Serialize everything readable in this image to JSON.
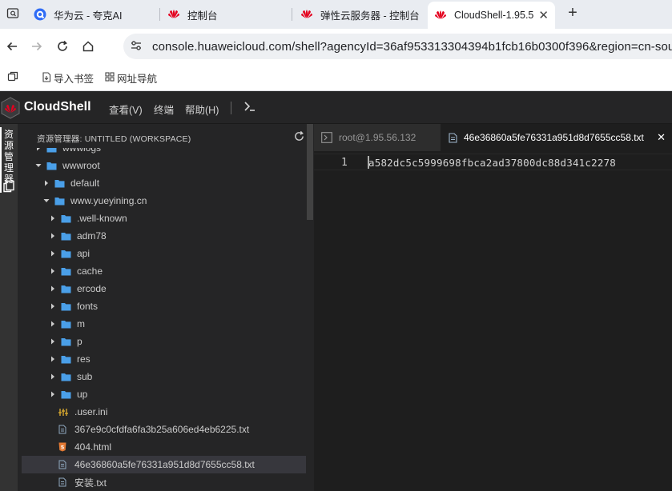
{
  "browser": {
    "tabs": [
      {
        "title": "华为云 - 夸克AI",
        "active": false
      },
      {
        "title": "控制台",
        "active": false
      },
      {
        "title": "弹性云服务器 - 控制台",
        "active": false
      },
      {
        "title": "CloudShell-1.95.5",
        "active": true
      }
    ],
    "new_tab": "+",
    "url": "console.huaweicloud.com/shell?agencyId=36af953313304394b1fcb16b0300f396&region=cn-sou",
    "bookmarks": [
      {
        "label": "导入书签"
      },
      {
        "label": "网址导航"
      }
    ]
  },
  "app": {
    "title": "CloudShell",
    "menu": [
      "查看(V)",
      "终端",
      "帮助(H)"
    ],
    "terminal_glyph": "›_",
    "activity_label": "资源管理器"
  },
  "explorer": {
    "header": "资源管理器: UNTITLED (WORKSPACE)",
    "tree": [
      {
        "label": "wwwlogs",
        "type": "folder",
        "depth": 1,
        "expanded": false,
        "partial": true
      },
      {
        "label": "wwwroot",
        "type": "folder",
        "depth": 1,
        "expanded": true
      },
      {
        "label": "default",
        "type": "folder",
        "depth": 2,
        "expanded": false
      },
      {
        "label": "www.yueyining.cn",
        "type": "folder",
        "depth": 2,
        "expanded": true
      },
      {
        "label": ".well-known",
        "type": "folder",
        "depth": 3,
        "expanded": false
      },
      {
        "label": "adm78",
        "type": "folder",
        "depth": 3,
        "expanded": false
      },
      {
        "label": "api",
        "type": "folder",
        "depth": 3,
        "expanded": false
      },
      {
        "label": "cache",
        "type": "folder",
        "depth": 3,
        "expanded": false
      },
      {
        "label": "ercode",
        "type": "folder",
        "depth": 3,
        "expanded": false
      },
      {
        "label": "fonts",
        "type": "folder",
        "depth": 3,
        "expanded": false
      },
      {
        "label": "m",
        "type": "folder",
        "depth": 3,
        "expanded": false
      },
      {
        "label": "p",
        "type": "folder",
        "depth": 3,
        "expanded": false
      },
      {
        "label": "res",
        "type": "folder",
        "depth": 3,
        "expanded": false
      },
      {
        "label": "sub",
        "type": "folder",
        "depth": 3,
        "expanded": false
      },
      {
        "label": "up",
        "type": "folder",
        "depth": 3,
        "expanded": false
      },
      {
        "label": ".user.ini",
        "type": "ini",
        "depth": 3
      },
      {
        "label": "367e9c0cfdfa6fa3b25a606ed4eb6225.txt",
        "type": "txt",
        "depth": 3
      },
      {
        "label": "404.html",
        "type": "html",
        "depth": 3
      },
      {
        "label": "46e36860a5fe76331a951d8d7655cc58.txt",
        "type": "txt",
        "depth": 3,
        "selected": true
      },
      {
        "label": "安装.txt",
        "type": "txt",
        "depth": 3
      }
    ]
  },
  "editor": {
    "tabs": [
      {
        "label": "root@1.95.56.132",
        "active": false
      },
      {
        "label": "46e36860a5fe76331a951d8d7655cc58.txt",
        "active": true
      }
    ],
    "line_number": "1",
    "content": "a582dc5c5999698fbca2ad37800dc88d341c2278"
  },
  "colors": {
    "folder": "#4a9fe8",
    "selection": "#37373d",
    "huawei_red": "#e4001e",
    "html_icon": "#e37933",
    "ini_icon": "#d7a82e"
  }
}
